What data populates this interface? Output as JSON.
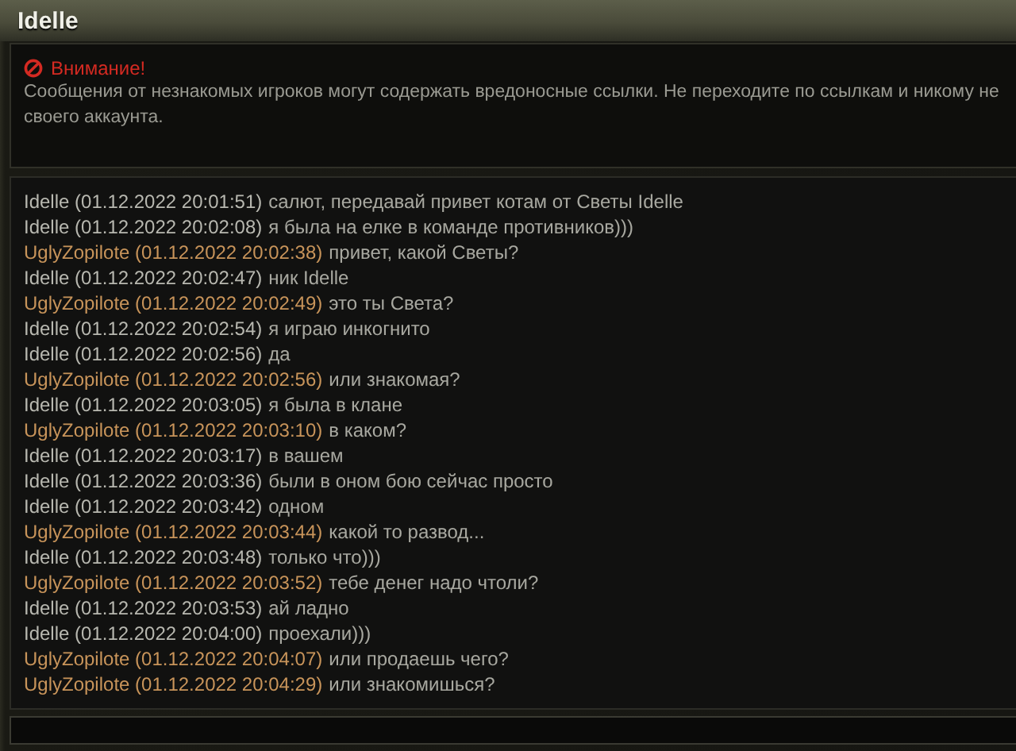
{
  "window": {
    "title": "Idelle"
  },
  "warning": {
    "title": "Внимание!",
    "lines": [
      "Сообщения от незнакомых игроков могут содержать вредоносные ссылки. Не переходите по ссылкам и никому не",
      "своего аккаунта."
    ]
  },
  "messages": [
    {
      "kind": "contact",
      "sender": "Idelle (01.12.2022 20:01:51)",
      "text": "салют, передавай привет котам от Светы Idelle"
    },
    {
      "kind": "contact",
      "sender": "Idelle (01.12.2022 20:02:08)",
      "text": "я была на елке в команде противников)))"
    },
    {
      "kind": "self",
      "sender": "UglyZopilote (01.12.2022 20:02:38)",
      "text": "привет, какой Светы?"
    },
    {
      "kind": "contact",
      "sender": "Idelle (01.12.2022 20:02:47)",
      "text": "ник Idelle"
    },
    {
      "kind": "self",
      "sender": "UglyZopilote (01.12.2022 20:02:49)",
      "text": "это ты Света?"
    },
    {
      "kind": "contact",
      "sender": "Idelle (01.12.2022 20:02:54)",
      "text": "я играю инкогнито"
    },
    {
      "kind": "contact",
      "sender": "Idelle (01.12.2022 20:02:56)",
      "text": "да"
    },
    {
      "kind": "self",
      "sender": "UglyZopilote (01.12.2022 20:02:56)",
      "text": "или знакомая?"
    },
    {
      "kind": "contact",
      "sender": "Idelle (01.12.2022 20:03:05)",
      "text": "я была в клане"
    },
    {
      "kind": "self",
      "sender": "UglyZopilote (01.12.2022 20:03:10)",
      "text": "в каком?"
    },
    {
      "kind": "contact",
      "sender": "Idelle (01.12.2022 20:03:17)",
      "text": "в вашем"
    },
    {
      "kind": "contact",
      "sender": "Idelle (01.12.2022 20:03:36)",
      "text": "были в оном бою сейчас просто"
    },
    {
      "kind": "contact",
      "sender": "Idelle (01.12.2022 20:03:42)",
      "text": "одном"
    },
    {
      "kind": "self",
      "sender": "UglyZopilote (01.12.2022 20:03:44)",
      "text": "какой то развод..."
    },
    {
      "kind": "contact",
      "sender": "Idelle (01.12.2022 20:03:48)",
      "text": "только что)))"
    },
    {
      "kind": "self",
      "sender": "UglyZopilote (01.12.2022 20:03:52)",
      "text": "тебе денег надо чтоли?"
    },
    {
      "kind": "contact",
      "sender": "Idelle (01.12.2022 20:03:53)",
      "text": "ай ладно"
    },
    {
      "kind": "contact",
      "sender": "Idelle (01.12.2022 20:04:00)",
      "text": "проехали)))"
    },
    {
      "kind": "self",
      "sender": "UglyZopilote (01.12.2022 20:04:07)",
      "text": "или продаешь чего?"
    },
    {
      "kind": "self",
      "sender": "UglyZopilote (01.12.2022 20:04:29)",
      "text": "или знакомишься?"
    }
  ]
}
